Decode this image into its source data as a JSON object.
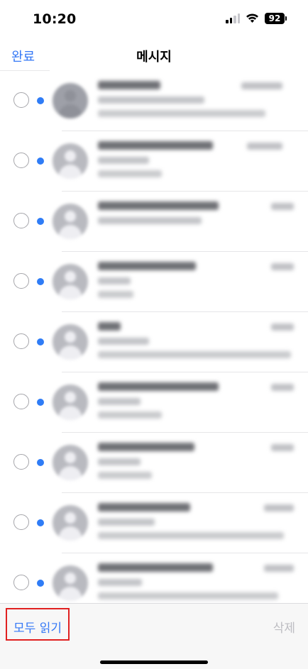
{
  "status_bar": {
    "time": "10:20",
    "battery": "92",
    "icons": [
      "cellular-signal-icon",
      "wifi-icon",
      "battery-icon"
    ]
  },
  "nav": {
    "done_label": "완료",
    "title": "메시지"
  },
  "messages": {
    "count_visible": 9,
    "content_obscured": true
  },
  "toolbar": {
    "mark_all_read_label": "모두 읽기",
    "delete_label": "삭제",
    "highlight_color": "#e02020"
  },
  "colors": {
    "accent": "#3478f6",
    "unread_dot": "#2f7cf6",
    "disabled": "#bdbdc2"
  }
}
